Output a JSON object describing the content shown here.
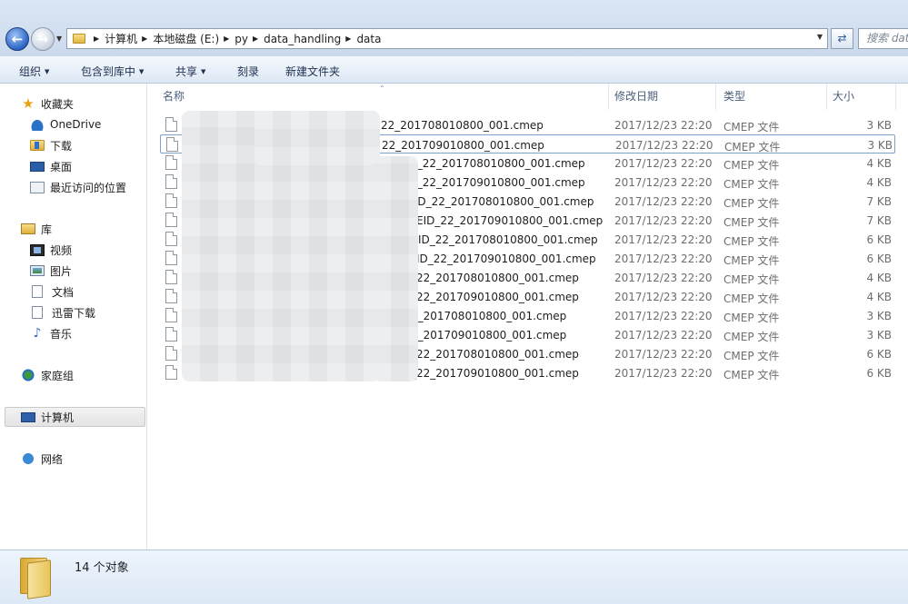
{
  "address_bar": {
    "crumbs": [
      "计算机",
      "本地磁盘 (E:)",
      "py",
      "data_handling",
      "data"
    ],
    "search_placeholder": "搜索 data"
  },
  "toolbar": {
    "organize": "组织",
    "include_in_library": "包含到库中",
    "share": "共享",
    "burn": "刻录",
    "new_folder": "新建文件夹"
  },
  "nav": {
    "favorites": "收藏夹",
    "onedrive": "OneDrive",
    "downloads": "下载",
    "desktop": "桌面",
    "recent": "最近访问的位置",
    "libraries": "库",
    "videos": "视频",
    "pictures": "图片",
    "documents": "文档",
    "xunlei": "迅雷下载",
    "music": "音乐",
    "homegroup": "家庭组",
    "computer": "计算机",
    "network": "网络"
  },
  "columns": {
    "name": "名称",
    "modified": "修改日期",
    "type": "类型",
    "size": "大小"
  },
  "files": [
    {
      "name": "22_201708010800_001.cmep",
      "modified": "2017/12/23 22:20",
      "type": "CMEP 文件",
      "size": "3 KB"
    },
    {
      "name": "22_201709010800_001.cmep",
      "modified": "2017/12/23 22:20",
      "type": "CMEP 文件",
      "size": "3 KB"
    },
    {
      "name": "ID_22_201708010800_001.cmep",
      "modified": "2017/12/23 22:20",
      "type": "CMEP 文件",
      "size": "4 KB"
    },
    {
      "name": "ID_22_201709010800_001.cmep",
      "modified": "2017/12/23 22:20",
      "type": "CMEP 文件",
      "size": "4 KB"
    },
    {
      "name": ".ID_22_201708010800_001.cmep",
      "modified": "2017/12/23 22:20",
      "type": "CMEP 文件",
      "size": "7 KB"
    },
    {
      "name": "EID_22_201709010800_001.cmep",
      "modified": "2017/12/23 22:20",
      "type": "CMEP 文件",
      "size": "7 KB"
    },
    {
      "name": "ID_22_201708010800_001.cmep",
      "modified": "2017/12/23 22:20",
      "type": "CMEP 文件",
      "size": "6 KB"
    },
    {
      "name": "ID_22_201709010800_001.cmep",
      "modified": "2017/12/23 22:20",
      "type": "CMEP 文件",
      "size": "6 KB"
    },
    {
      "name": "_22_201708010800_001.cmep",
      "modified": "2017/12/23 22:20",
      "type": "CMEP 文件",
      "size": "4 KB"
    },
    {
      "name": "_22_201709010800_001.cmep",
      "modified": "2017/12/23 22:20",
      "type": "CMEP 文件",
      "size": "4 KB"
    },
    {
      "name": "2_201708010800_001.cmep",
      "modified": "2017/12/23 22:20",
      "type": "CMEP 文件",
      "size": "3 KB"
    },
    {
      "name": "2_201709010800_001.cmep",
      "modified": "2017/12/23 22:20",
      "type": "CMEP 文件",
      "size": "3 KB"
    },
    {
      "name": "_22_201708010800_001.cmep",
      "modified": "2017/12/23 22:20",
      "type": "CMEP 文件",
      "size": "6 KB"
    },
    {
      "name": "_22_201709010800_001.cmep",
      "modified": "2017/12/23 22:20",
      "type": "CMEP 文件",
      "size": "6 KB"
    }
  ],
  "details": {
    "count_text": "14 个对象"
  }
}
